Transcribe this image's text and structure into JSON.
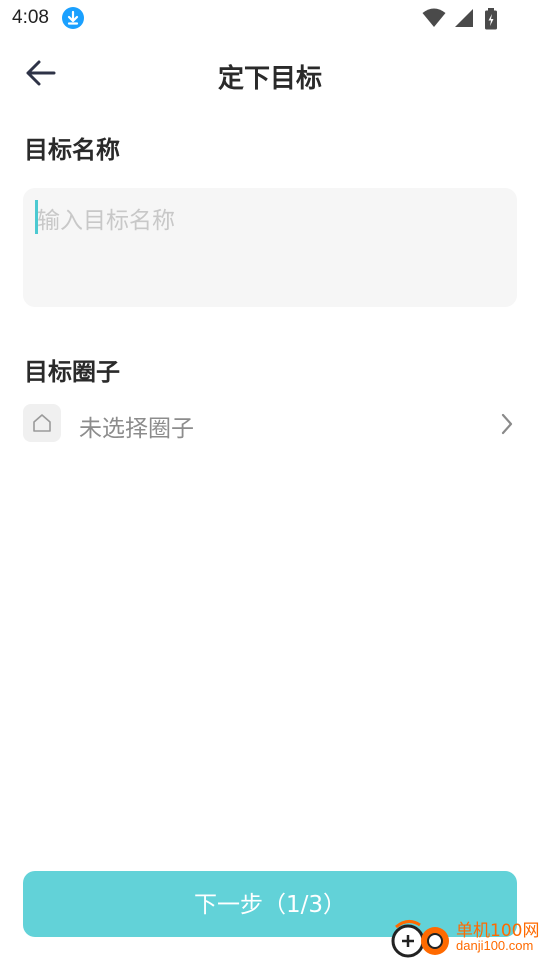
{
  "status_bar": {
    "time": "4:08",
    "icons": [
      "download-icon",
      "wifi-icon",
      "signal-icon",
      "battery-icon"
    ]
  },
  "header": {
    "title": "定下目标",
    "back_icon": "arrow-left-icon"
  },
  "goal_name": {
    "label": "目标名称",
    "placeholder": "输入目标名称",
    "value": ""
  },
  "goal_circle": {
    "label": "目标圈子",
    "value_text": "未选择圈子",
    "icon": "home-icon",
    "chevron": "chevron-right-icon"
  },
  "footer": {
    "next_label": "下一步（1/3）"
  },
  "watermark": {
    "cn": "单机100网",
    "en": "danji100.com"
  },
  "colors": {
    "accent": "#62d2d8",
    "cursor": "#4cc9d1",
    "input_bg": "#f6f6f6",
    "watermark": "#ff6a00"
  }
}
